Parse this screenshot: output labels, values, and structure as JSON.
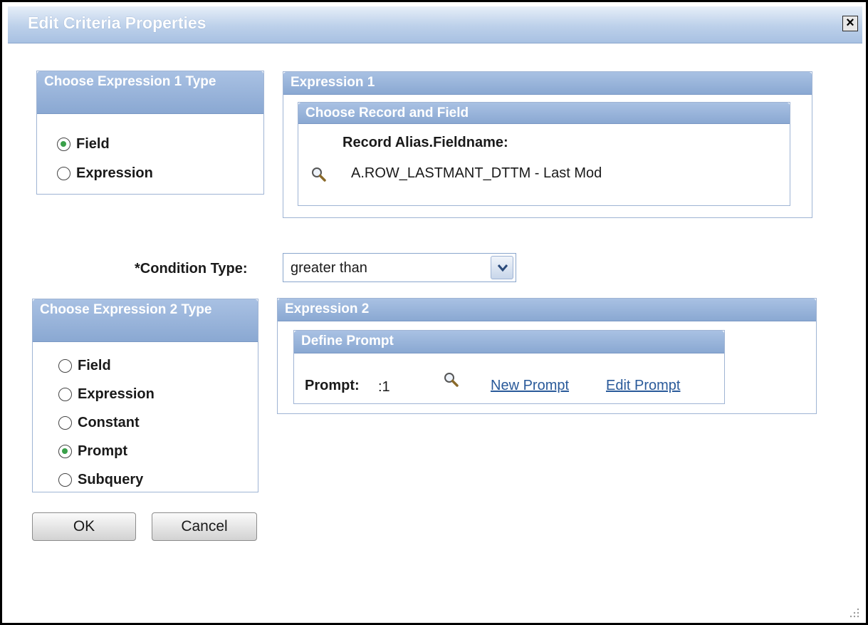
{
  "dialog": {
    "title": "Edit Criteria Properties",
    "close_label": "×"
  },
  "expr1_type": {
    "header": "Choose Expression 1 Type",
    "options": [
      {
        "label": "Field",
        "checked": true
      },
      {
        "label": "Expression",
        "checked": false
      }
    ]
  },
  "expr1": {
    "header": "Expression 1",
    "sub_header": "Choose Record and Field",
    "field_label": "Record Alias.Fieldname:",
    "field_value": "A.ROW_LASTMANT_DTTM - Last Mod",
    "lookup_icon": "magnifier-icon"
  },
  "condition": {
    "label": "*Condition Type:",
    "value": "greater than"
  },
  "expr2_type": {
    "header": "Choose Expression 2 Type",
    "options": [
      {
        "label": "Field",
        "checked": false
      },
      {
        "label": "Expression",
        "checked": false
      },
      {
        "label": "Constant",
        "checked": false
      },
      {
        "label": "Prompt",
        "checked": true
      },
      {
        "label": "Subquery",
        "checked": false
      }
    ]
  },
  "expr2": {
    "header": "Expression 2",
    "sub_header": "Define Prompt",
    "prompt_label": "Prompt:",
    "prompt_value": ":1",
    "new_prompt": "New Prompt",
    "edit_prompt": "Edit Prompt"
  },
  "buttons": {
    "ok": "OK",
    "cancel": "Cancel"
  },
  "colors": {
    "header_blue": "#8aa8d2",
    "link_blue": "#2a5a9a",
    "radio_checked": "#3aa04a"
  }
}
